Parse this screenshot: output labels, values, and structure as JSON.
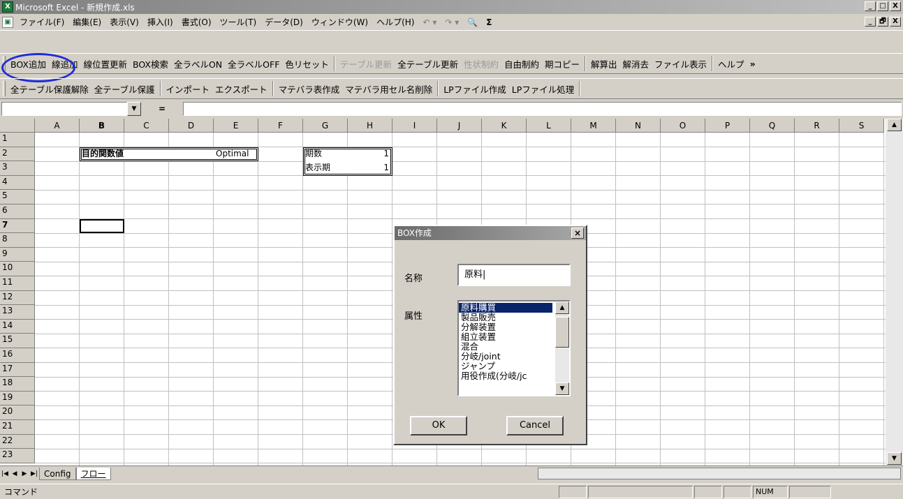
{
  "window": {
    "title": "Microsoft Excel - 新規作成.xls",
    "app_icon": "excel-icon",
    "buttons": [
      "_",
      "□",
      "X"
    ]
  },
  "menu": {
    "items": [
      "ファイル(F)",
      "編集(E)",
      "表示(V)",
      "挿入(I)",
      "書式(O)",
      "ツール(T)",
      "データ(D)",
      "ウィンドウ(W)",
      "ヘルプ(H)"
    ],
    "undo": "↶ ▾",
    "redo": "↷ ▾",
    "find": "🔍",
    "sigma": "Σ",
    "doc_buttons": [
      "_",
      "🗗",
      "X"
    ]
  },
  "toolbar1": {
    "items": [
      "BOX追加",
      "線追加",
      "線位置更新",
      "BOX検索",
      "全ラベルON",
      "全ラベルOFF",
      "色リセット"
    ],
    "dim_items": [
      "テーブル更新"
    ],
    "items2": [
      "全テーブル更新"
    ],
    "dim2": [
      "性状制約"
    ],
    "items3": [
      "自由制約",
      "期コピー"
    ],
    "items4": [
      "解算出",
      "解消去",
      "ファイル表示"
    ],
    "help": "ヘルプ",
    "more": "»"
  },
  "toolbar2": {
    "items": [
      "全テーブル保護解除",
      "全テーブル保護"
    ],
    "items2": [
      "インポート",
      "エクスポート"
    ],
    "items3": [
      "マテバラ表作成",
      "マテバラ用セル名削除"
    ],
    "items4": [
      "LPファイル作成",
      "LPファイル処理"
    ]
  },
  "formula": {
    "name_box": "",
    "eq": "=",
    "value": ""
  },
  "columns": [
    "A",
    "B",
    "C",
    "D",
    "E",
    "F",
    "G",
    "H",
    "I",
    "J",
    "K",
    "L",
    "M",
    "N",
    "O",
    "P",
    "Q",
    "R",
    "S"
  ],
  "rows": [
    "1",
    "2",
    "3",
    "4",
    "5",
    "6",
    "7",
    "8",
    "9",
    "10",
    "11",
    "12",
    "13",
    "14",
    "15",
    "16",
    "17",
    "18",
    "19",
    "20",
    "21",
    "22",
    "23"
  ],
  "cells": {
    "b2": "目的関数値",
    "e2": "Optimal",
    "g2": "期数",
    "h2": "1",
    "g3": "表示期",
    "h3": "1"
  },
  "active_cell": "B7",
  "sheets": {
    "tabs": [
      "Config",
      "フロー"
    ],
    "active": "フロー"
  },
  "status": {
    "text": "コマンド",
    "num": "NUM"
  },
  "dialog": {
    "title": "BOX作成",
    "name_label": "名称",
    "name_value": "原料|",
    "attr_label": "属性",
    "attr_options": [
      "原料購買",
      "製品販売",
      "分解装置",
      "組立装置",
      "混合",
      "分岐/joint",
      "ジャンプ",
      "用役作成(分岐/jc"
    ],
    "selected": "原料購買",
    "ok": "OK",
    "cancel": "Cancel"
  },
  "colors": {
    "selection": "#0a246a",
    "highlight_circle": "#1f2cd6",
    "face": "#d4d0c8"
  }
}
